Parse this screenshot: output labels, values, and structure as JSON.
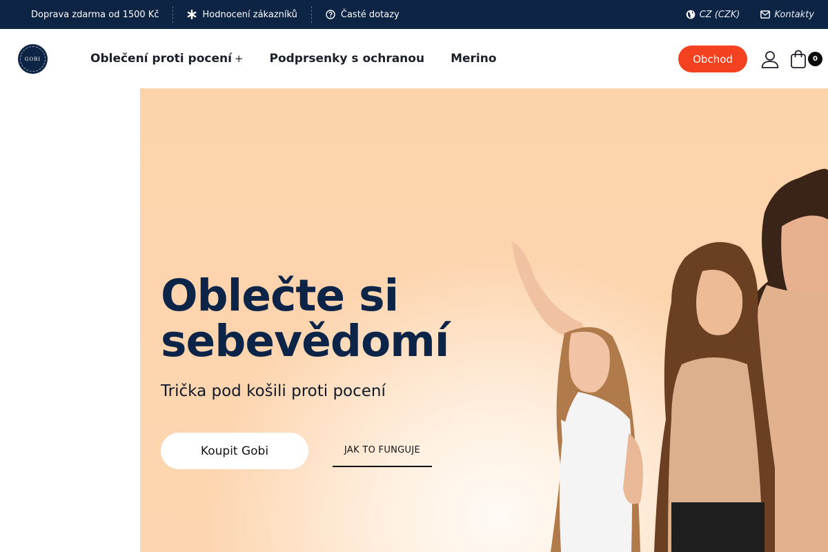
{
  "topbar": {
    "shipping_text": "Doprava zdarma od 1500 Kč",
    "reviews_label": "Hodnocení zákazníků",
    "faq_label": "Časté dotazy",
    "currency_label": "CZ (CZK)",
    "contacts_label": "Kontakty"
  },
  "header": {
    "logo_text": "GOBI",
    "nav": [
      {
        "label": "Oblečení proti pocení",
        "has_submenu": true,
        "submenu_glyph": "+"
      },
      {
        "label": "Podprsenky s ochranou"
      },
      {
        "label": "Merino"
      }
    ],
    "shop_button": "Obchod",
    "cart_count": "0"
  },
  "hero": {
    "title_line1": "Oblečte si",
    "title_line2": "sebevědomí",
    "subtitle": "Trička pod košili proti pocení",
    "primary_cta": "Koupit Gobi",
    "secondary_cta": "JAK TO FUNGUJE"
  },
  "colors": {
    "topbar_bg": "#0e2445",
    "accent": "#f4411f",
    "hero_bg": "#fdd3ab",
    "title_color": "#0b2447"
  }
}
